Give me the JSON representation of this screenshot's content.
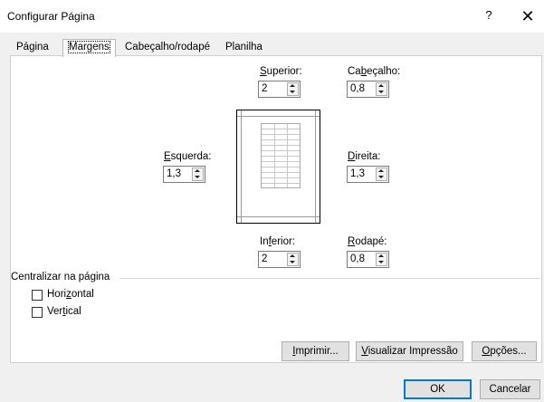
{
  "window": {
    "title": "Configurar Página",
    "help_label": "?",
    "close_label": "✕"
  },
  "tabs": [
    {
      "label": "Página"
    },
    {
      "label": "Margens"
    },
    {
      "label": "Cabeçalho/rodapé"
    },
    {
      "label": "Planilha"
    }
  ],
  "margins": {
    "superior": {
      "label_pre": "",
      "label_key": "S",
      "label_post": "uperior:",
      "value": "2"
    },
    "cabecalho": {
      "label_pre": "Ca",
      "label_key": "b",
      "label_post": "eçalho:",
      "value": "0,8"
    },
    "esquerda": {
      "label_pre": "",
      "label_key": "E",
      "label_post": "squerda:",
      "value": "1,3"
    },
    "direita": {
      "label_pre": "",
      "label_key": "D",
      "label_post": "ireita:",
      "value": "1,3"
    },
    "inferior": {
      "label_pre": "In",
      "label_key": "f",
      "label_post": "erior:",
      "value": "2"
    },
    "rodape": {
      "label_pre": "",
      "label_key": "R",
      "label_post": "odapé:",
      "value": "0,8"
    }
  },
  "center": {
    "title": "Centralizar na página",
    "horizontal": {
      "label_pre": "Hori",
      "label_key": "z",
      "label_post": "ontal",
      "checked": false
    },
    "vertical": {
      "label_pre": "Ver",
      "label_key": "t",
      "label_post": "ical",
      "checked": false
    }
  },
  "buttons": {
    "imprimir": {
      "label_pre": "",
      "label_key": "I",
      "label_post": "mprimir..."
    },
    "visualizar": {
      "label_pre": "",
      "label_key": "V",
      "label_post": "isualizar Impressão"
    },
    "opcoes": {
      "label_pre": "",
      "label_key": "O",
      "label_post": "pções..."
    },
    "ok": "OK",
    "cancelar": "Cancelar"
  },
  "colors": {
    "dialog_bg": "#f0f0f0",
    "panel_bg": "#ffffff",
    "default_button_border": "#0078d7"
  }
}
